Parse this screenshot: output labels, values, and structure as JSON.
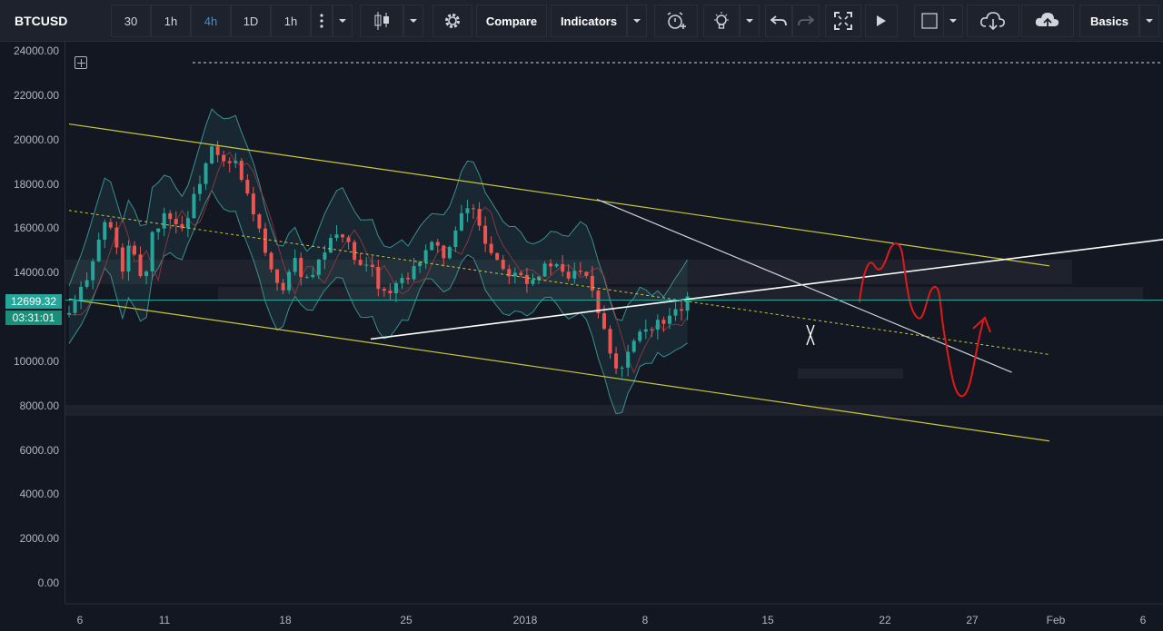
{
  "toolbar": {
    "symbol": "BTCUSD",
    "intervals": [
      "30",
      "1h",
      "4h",
      "1D",
      "1h"
    ],
    "active_interval": "4h",
    "compare_label": "Compare",
    "indicators_label": "Indicators",
    "layout_label": "Basics",
    "icons": [
      "more-vertical-icon",
      "candlestick-icon",
      "gear-icon",
      "alarm-clock-icon",
      "lightbulb-icon",
      "undo-icon",
      "redo-icon",
      "fullscreen-icon",
      "play-icon",
      "square-icon",
      "cloud-download-icon",
      "cloud-upload-icon"
    ]
  },
  "price_axis": {
    "ticks": [
      "24000.00",
      "22000.00",
      "20000.00",
      "18000.00",
      "16000.00",
      "14000.00",
      "10000.00",
      "8000.00",
      "6000.00",
      "4000.00",
      "2000.00",
      "0.00"
    ],
    "current_price": "12699.32",
    "countdown": "03:31:01"
  },
  "time_axis": {
    "ticks": [
      "6",
      "11",
      "18",
      "25",
      "2018",
      "8",
      "15",
      "22",
      "27",
      "Feb",
      "6"
    ]
  },
  "colors": {
    "background": "#131722",
    "up_candle": "#26a69a",
    "down_candle": "#ef5350",
    "channel": "#c8c83a",
    "trendline": "#ffffff",
    "bollinger": "#3a8f8f",
    "drawing": "#e01a1a",
    "price_line": "#26a69a"
  },
  "chart_data": {
    "type": "candlestick",
    "symbol": "BTCUSD",
    "timeframe": "4h",
    "ylim": [
      0,
      24000
    ],
    "x_labels": [
      "6",
      "11",
      "18",
      "25",
      "2018",
      "8",
      "15",
      "22",
      "27",
      "Feb",
      "6"
    ],
    "last_price": 12699.32,
    "price_path": [
      [
        0,
        12100
      ],
      [
        2,
        13500
      ],
      [
        4,
        15500
      ],
      [
        5,
        16500
      ],
      [
        6,
        15500
      ],
      [
        7,
        14000
      ],
      [
        8,
        15200
      ],
      [
        10,
        13500
      ],
      [
        11,
        15800
      ],
      [
        12,
        16200
      ],
      [
        13,
        16800
      ],
      [
        14,
        16300
      ],
      [
        15,
        16000
      ],
      [
        16,
        16800
      ],
      [
        17,
        17800
      ],
      [
        18,
        18800
      ],
      [
        19,
        19600
      ],
      [
        20,
        19000
      ],
      [
        21,
        18800
      ],
      [
        22,
        19000
      ],
      [
        23,
        18000
      ],
      [
        24,
        17200
      ],
      [
        25,
        16200
      ],
      [
        26,
        14800
      ],
      [
        27,
        13800
      ],
      [
        28,
        13000
      ],
      [
        29,
        14000
      ],
      [
        30,
        14500
      ],
      [
        31,
        13800
      ],
      [
        32,
        13500
      ],
      [
        33,
        14300
      ],
      [
        34,
        15000
      ],
      [
        35,
        15500
      ],
      [
        36,
        16000
      ],
      [
        37,
        15200
      ],
      [
        38,
        14500
      ],
      [
        39,
        14000
      ],
      [
        40,
        14400
      ],
      [
        41,
        13500
      ],
      [
        42,
        13000
      ],
      [
        43,
        13200
      ],
      [
        44,
        13700
      ],
      [
        45,
        13500
      ],
      [
        46,
        14300
      ],
      [
        47,
        15000
      ],
      [
        48,
        15200
      ],
      [
        49,
        15000
      ],
      [
        50,
        14800
      ],
      [
        51,
        15500
      ],
      [
        52,
        16500
      ],
      [
        53,
        17000
      ],
      [
        54,
        16700
      ],
      [
        55,
        15500
      ],
      [
        56,
        15000
      ],
      [
        57,
        14500
      ],
      [
        58,
        14000
      ],
      [
        59,
        14200
      ],
      [
        60,
        14000
      ],
      [
        61,
        13600
      ],
      [
        62,
        13900
      ],
      [
        63,
        14200
      ],
      [
        64,
        14400
      ],
      [
        65,
        14100
      ],
      [
        66,
        13700
      ],
      [
        67,
        14000
      ],
      [
        68,
        14300
      ],
      [
        69,
        13800
      ],
      [
        70,
        12500
      ],
      [
        71,
        11500
      ],
      [
        72,
        10200
      ],
      [
        73,
        9400
      ],
      [
        74,
        10500
      ],
      [
        75,
        11000
      ],
      [
        76,
        11800
      ],
      [
        77,
        11300
      ],
      [
        78,
        11800
      ],
      [
        79,
        11500
      ],
      [
        80,
        12000
      ],
      [
        81,
        12300
      ],
      [
        82,
        12699
      ]
    ],
    "trendlines": [
      {
        "name": "upper-channel",
        "from": [
          0,
          20700
        ],
        "to": [
          130,
          14300
        ]
      },
      {
        "name": "lower-channel",
        "from": [
          0,
          12800
        ],
        "to": [
          130,
          6400
        ]
      },
      {
        "name": "mid-channel",
        "from": [
          0,
          16800
        ],
        "to": [
          130,
          10300
        ]
      },
      {
        "name": "support-rising",
        "from": [
          40,
          11000
        ],
        "to": [
          150,
          15700
        ]
      },
      {
        "name": "resistance-falling",
        "from": [
          70,
          17300
        ],
        "to": [
          125,
          9500
        ]
      }
    ]
  }
}
